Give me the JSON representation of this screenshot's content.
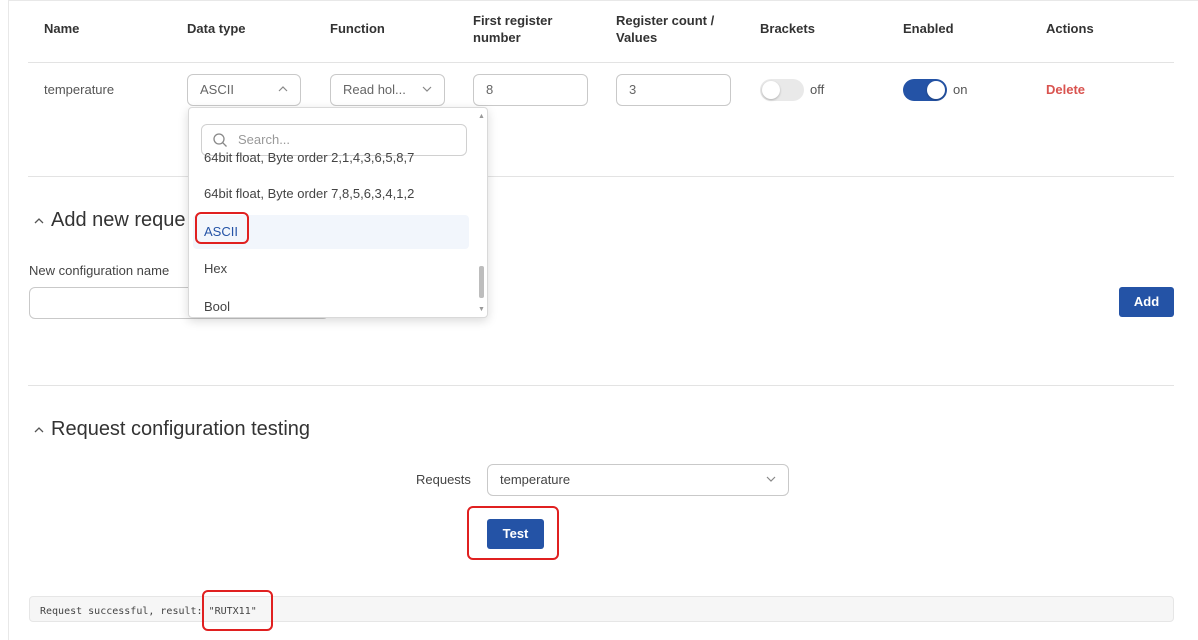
{
  "table": {
    "headers": {
      "name": "Name",
      "data_type": "Data type",
      "function": "Function",
      "first_register_line1": "First register",
      "first_register_line2": "number",
      "register_count_line1": "Register count /",
      "register_count_line2": "Values",
      "brackets": "Brackets",
      "enabled": "Enabled",
      "actions": "Actions"
    },
    "row": {
      "name": "temperature",
      "data_type": "ASCII",
      "function": "Read hol...",
      "first_register": "8",
      "register_count": "3",
      "brackets_state": "off",
      "enabled_state": "on",
      "delete_label": "Delete"
    }
  },
  "dropdown": {
    "search_placeholder": "Search...",
    "items": [
      "64bit float, Byte order 2,1,4,3,6,5,8,7",
      "64bit float, Byte order 7,8,5,6,3,4,1,2",
      "ASCII",
      "Hex",
      "Bool"
    ],
    "selected": "ASCII"
  },
  "add_section": {
    "title": "Add new reque",
    "name_label": "New configuration name",
    "add_button": "Add"
  },
  "testing_section": {
    "title": "Request configuration testing",
    "requests_label": "Requests",
    "requests_value": "temperature",
    "test_button": "Test",
    "result_prefix": "Request successful, result: ",
    "result_value": "\"RUTX11\""
  },
  "colors": {
    "primary": "#2453a6",
    "danger": "#d9534f",
    "highlight": "#e02020"
  }
}
